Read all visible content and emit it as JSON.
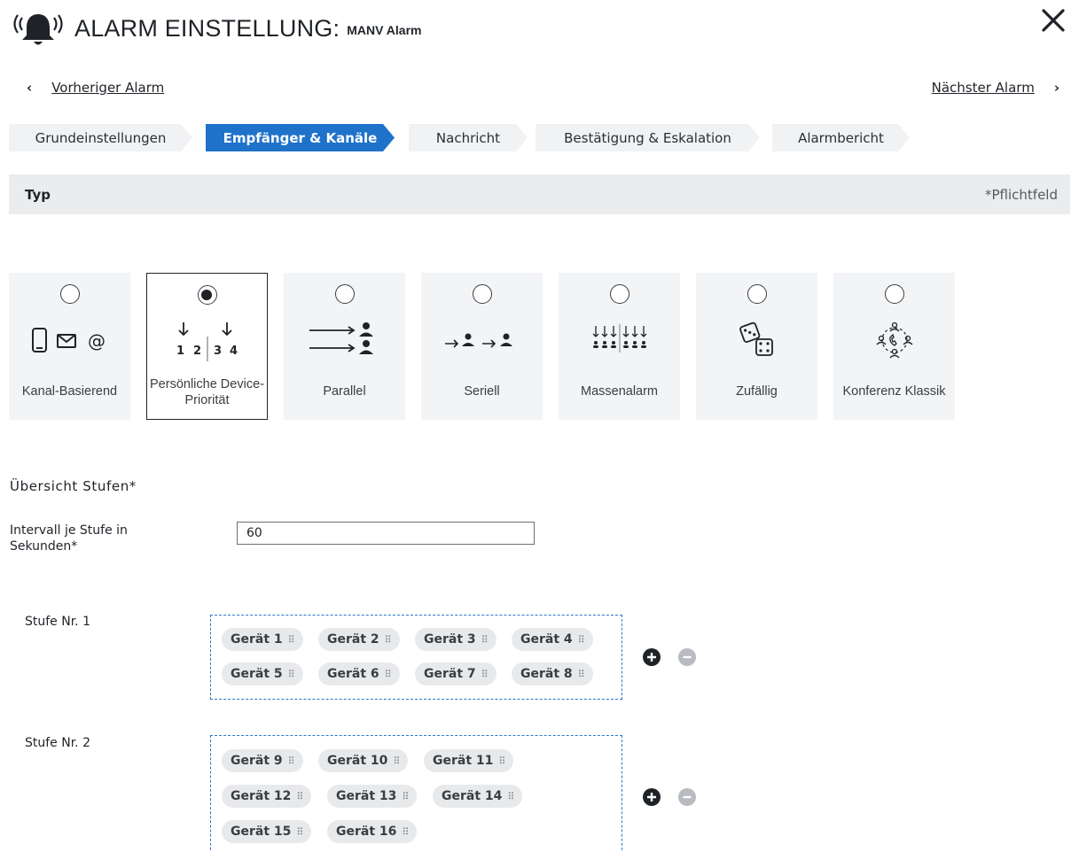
{
  "header": {
    "title": "ALARM EINSTELLUNG:",
    "subtitle": "MANV Alarm",
    "icons": {
      "alarm": "alarm-bell-icon",
      "close": "close-icon"
    }
  },
  "nav": {
    "prev_label": "Vorheriger Alarm",
    "next_label": "Nächster Alarm",
    "prev_chevron": "‹",
    "next_chevron": "›"
  },
  "steps": [
    {
      "label": "Grundeinstellungen",
      "active": false
    },
    {
      "label": "Empfänger & Kanäle",
      "active": true
    },
    {
      "label": "Nachricht",
      "active": false
    },
    {
      "label": "Bestätigung & Eskalation",
      "active": false
    },
    {
      "label": "Alarmbericht",
      "active": false
    }
  ],
  "section": {
    "title": "Typ",
    "required_note": "*Pflichtfeld"
  },
  "types": [
    {
      "label": "Kanal-Basierend",
      "selected": false,
      "icon": "device-mail-at-icon"
    },
    {
      "label": "Persönliche Device-Priorität",
      "selected": true,
      "icon": "device-priority-icon"
    },
    {
      "label": "Parallel",
      "selected": false,
      "icon": "parallel-icon"
    },
    {
      "label": "Seriell",
      "selected": false,
      "icon": "serial-icon"
    },
    {
      "label": "Massenalarm",
      "selected": false,
      "icon": "mass-alarm-icon"
    },
    {
      "label": "Zufällig",
      "selected": false,
      "icon": "dice-icon"
    },
    {
      "label": "Konferenz Klassik",
      "selected": false,
      "icon": "conference-icon"
    }
  ],
  "icon_text": {
    "priority_numbers": [
      "1",
      "2",
      "3",
      "4"
    ],
    "mail_at": "@"
  },
  "overview": {
    "title": "Übersicht Stufen*",
    "interval_label": "Intervall je Stufe in Sekunden*",
    "interval_value": "60"
  },
  "levels": [
    {
      "label": "Stufe Nr. 1",
      "devices": [
        "Gerät 1",
        "Gerät 2",
        "Gerät 3",
        "Gerät 4",
        "Gerät 5",
        "Gerät 6",
        "Gerät 7",
        "Gerät 8"
      ]
    },
    {
      "label": "Stufe Nr. 2",
      "devices": [
        "Gerät 9",
        "Gerät 10",
        "Gerät 11",
        "Gerät 12",
        "Gerät 13",
        "Gerät 14",
        "Gerät 15",
        "Gerät 16"
      ]
    }
  ],
  "colors": {
    "accent": "#1f72c9",
    "dropzone_border": "#2a78c8",
    "chip_bg": "#e8e9eb",
    "card_bg": "#f3f4f6"
  }
}
